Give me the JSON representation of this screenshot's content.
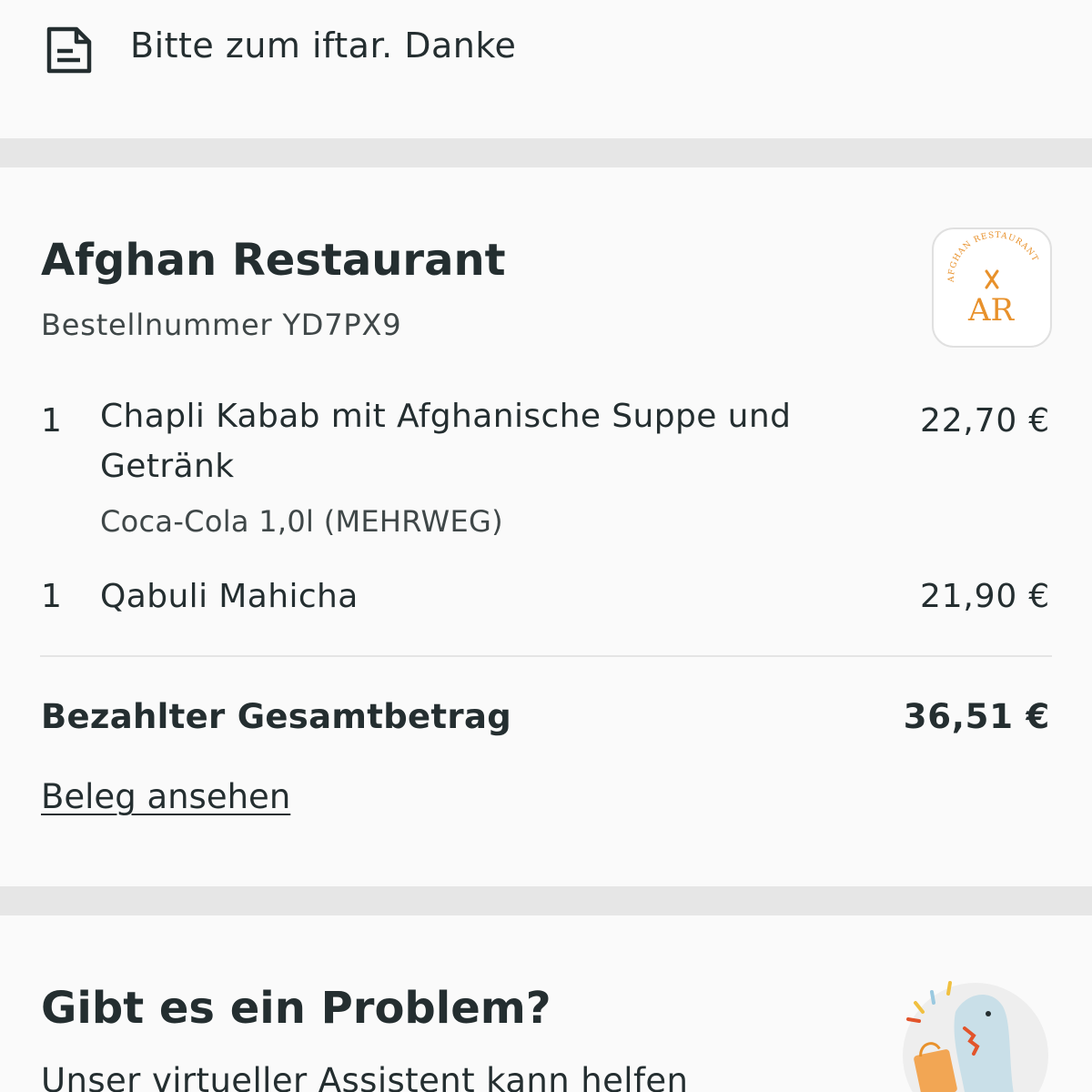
{
  "note": {
    "icon": "note-document-icon",
    "text": "Bitte zum iftar. Danke"
  },
  "order": {
    "restaurant_name": "Afghan Restaurant",
    "order_number": "Bestellnummer YD7PX9",
    "logo": {
      "icon": "restaurant-logo",
      "arc_text": "AFGHAN RESTAURANT",
      "initials": "AR",
      "accent_color": "#e8912b"
    },
    "items": [
      {
        "qty": "1",
        "name": "Chapli Kabab mit Afghanische Suppe und Getränk",
        "option": "Coca-Cola 1,0l (MEHRWEG)",
        "price": "22,70 €"
      },
      {
        "qty": "1",
        "name": "Qabuli Mahicha",
        "price": "21,90 €"
      }
    ],
    "total_label": "Bezahlter Gesamtbetrag",
    "total_value": "36,51 €",
    "receipt_link": "Beleg ansehen"
  },
  "problem": {
    "title": "Gibt es ein Problem?",
    "subtitle": "Unser virtueller Assistent kann helfen",
    "illustration": "assistant-illustration"
  },
  "colors": {
    "background": "#fafafa",
    "divider": "#e6e6e6",
    "text_primary": "#242e30",
    "accent": "#e8912b"
  }
}
